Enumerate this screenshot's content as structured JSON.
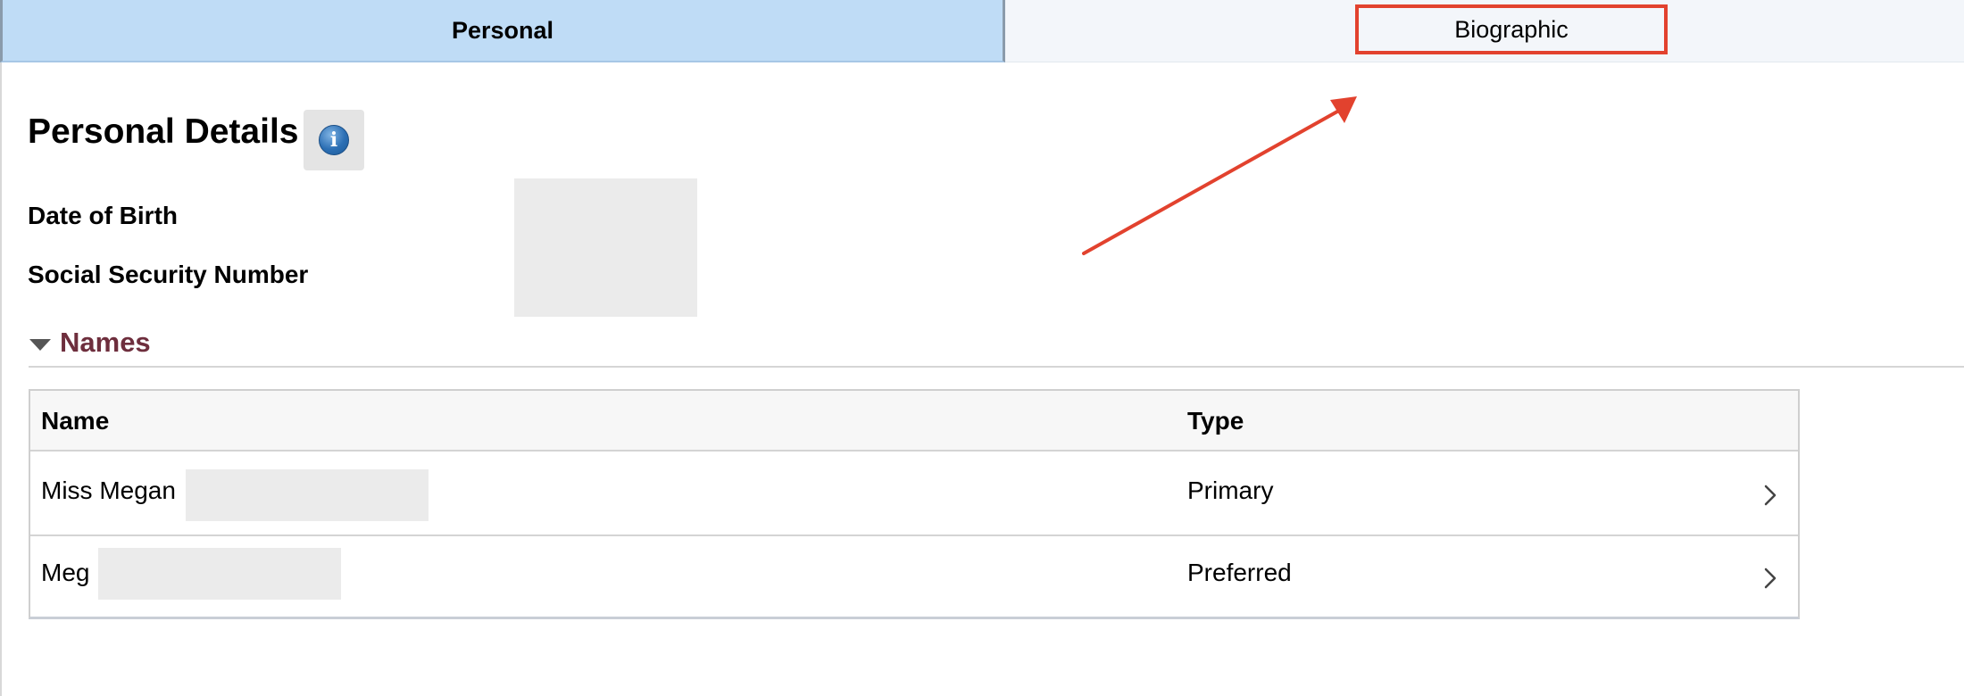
{
  "tabs": [
    {
      "label": "Personal",
      "active": true
    },
    {
      "label": "Biographic",
      "active": false,
      "highlighted": true
    }
  ],
  "details": {
    "title": "Personal Details",
    "info_icon": "info-icon",
    "fields": [
      {
        "label": "Date of Birth"
      },
      {
        "label": "Social Security Number"
      }
    ]
  },
  "names_section": {
    "title": "Names",
    "expanded": true,
    "columns": [
      "Name",
      "Type"
    ],
    "rows": [
      {
        "name": "Miss Megan",
        "type": "Primary"
      },
      {
        "name": "Meg",
        "type": "Preferred"
      }
    ]
  },
  "colors": {
    "active_tab": "#bfdcf6",
    "inactive_tab": "#f3f6fa",
    "annotation": "#e2422e",
    "section_title": "#6e2e3d",
    "redaction": "#ebebeb"
  }
}
